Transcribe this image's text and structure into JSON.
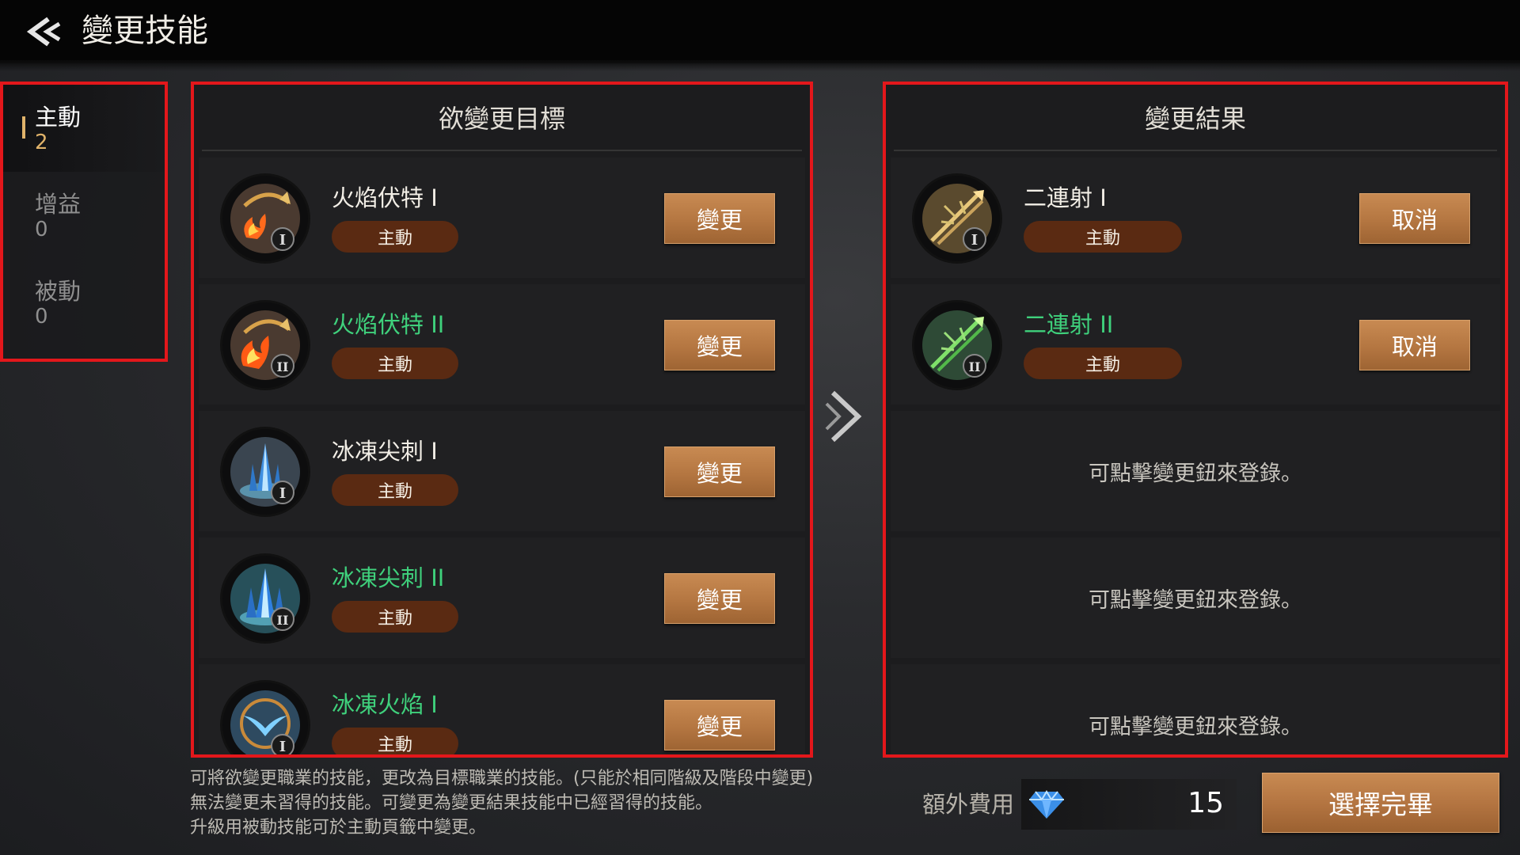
{
  "header": {
    "title": "變更技能",
    "back_icon": "back-arrow-icon"
  },
  "categories": [
    {
      "label": "主動",
      "count": "2",
      "active": true
    },
    {
      "label": "增益",
      "count": "0",
      "active": false
    },
    {
      "label": "被動",
      "count": "0",
      "active": false
    }
  ],
  "left_panel": {
    "title": "欲變更目標",
    "skills": [
      {
        "name": "火焰伏特 I",
        "tier": "I",
        "type": "主動",
        "button": "變更",
        "icon": "fire-bow-icon",
        "upgraded": false
      },
      {
        "name": "火焰伏特 II",
        "tier": "II",
        "type": "主動",
        "button": "變更",
        "icon": "fire-bow-icon",
        "upgraded": true
      },
      {
        "name": "冰凍尖刺 I",
        "tier": "I",
        "type": "主動",
        "button": "變更",
        "icon": "ice-spike-icon",
        "upgraded": false
      },
      {
        "name": "冰凍尖刺 II",
        "tier": "II",
        "type": "主動",
        "button": "變更",
        "icon": "ice-spike-icon",
        "upgraded": true
      },
      {
        "name": "冰凍火焰 I",
        "tier": "I",
        "type": "主動",
        "button": "變更",
        "icon": "frost-flame-icon",
        "upgraded": true
      }
    ]
  },
  "right_panel": {
    "title": "變更結果",
    "skills": [
      {
        "name": "二連射 I",
        "tier": "I",
        "type": "主動",
        "button": "取消",
        "icon": "double-shot-icon",
        "upgraded": false
      },
      {
        "name": "二連射 II",
        "tier": "II",
        "type": "主動",
        "button": "取消",
        "icon": "double-shot-icon",
        "upgraded": true
      }
    ],
    "empty_slots": [
      "可點擊變更鈕來登錄。",
      "可點擊變更鈕來登錄。",
      "可點擊變更鈕來登錄。"
    ]
  },
  "footer": {
    "notes": [
      "可將欲變更職業的技能，更改為目標職業的技能。(只能於相同階級及階段中變更)",
      "無法變更未習得的技能。可變更為變更結果技能中已經習得的技能。",
      "升級用被動技能可於主動頁籤中變更。"
    ],
    "cost_label": "額外費用",
    "cost_icon": "diamond-icon",
    "cost_value": "15",
    "confirm_button": "選擇完畢"
  },
  "colors": {
    "accent": "#b47641",
    "upgraded_text": "#3fd17c",
    "highlight_box": "#e3171b",
    "pill": "#5a2a12"
  }
}
